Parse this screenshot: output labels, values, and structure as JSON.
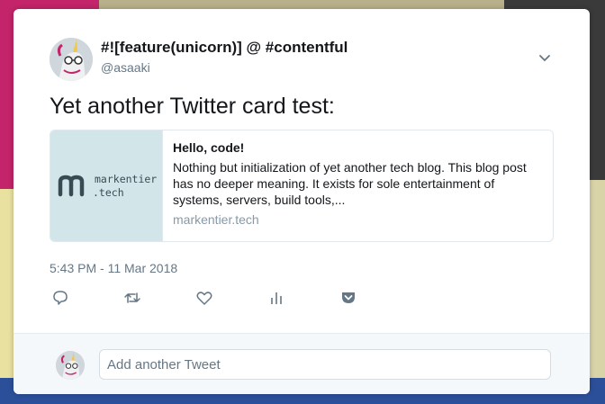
{
  "tweet": {
    "display_name": "#![feature(unicorn)] @ #contentful",
    "handle": "@asaaki",
    "text": "Yet another Twitter card test:",
    "timestamp": "5:43 PM - 11 Mar 2018"
  },
  "link_card": {
    "logo_line1": "markentier",
    "logo_line2": ".tech",
    "title": "Hello, code!",
    "description": "Nothing but initialization of yet another tech blog. This blog post has no deeper meaning. It exists for sole entertainment of systems, servers, build tools,...",
    "domain": "markentier.tech"
  },
  "actions": [
    "reply-icon",
    "retweet-icon",
    "like-icon",
    "analytics-icon",
    "pocket-icon"
  ],
  "reply": {
    "placeholder": "Add another Tweet"
  },
  "colors": {
    "text": "#14171a",
    "secondary": "#657786",
    "card_thumb_bg": "#d2e6ea",
    "icon": "#657786"
  }
}
